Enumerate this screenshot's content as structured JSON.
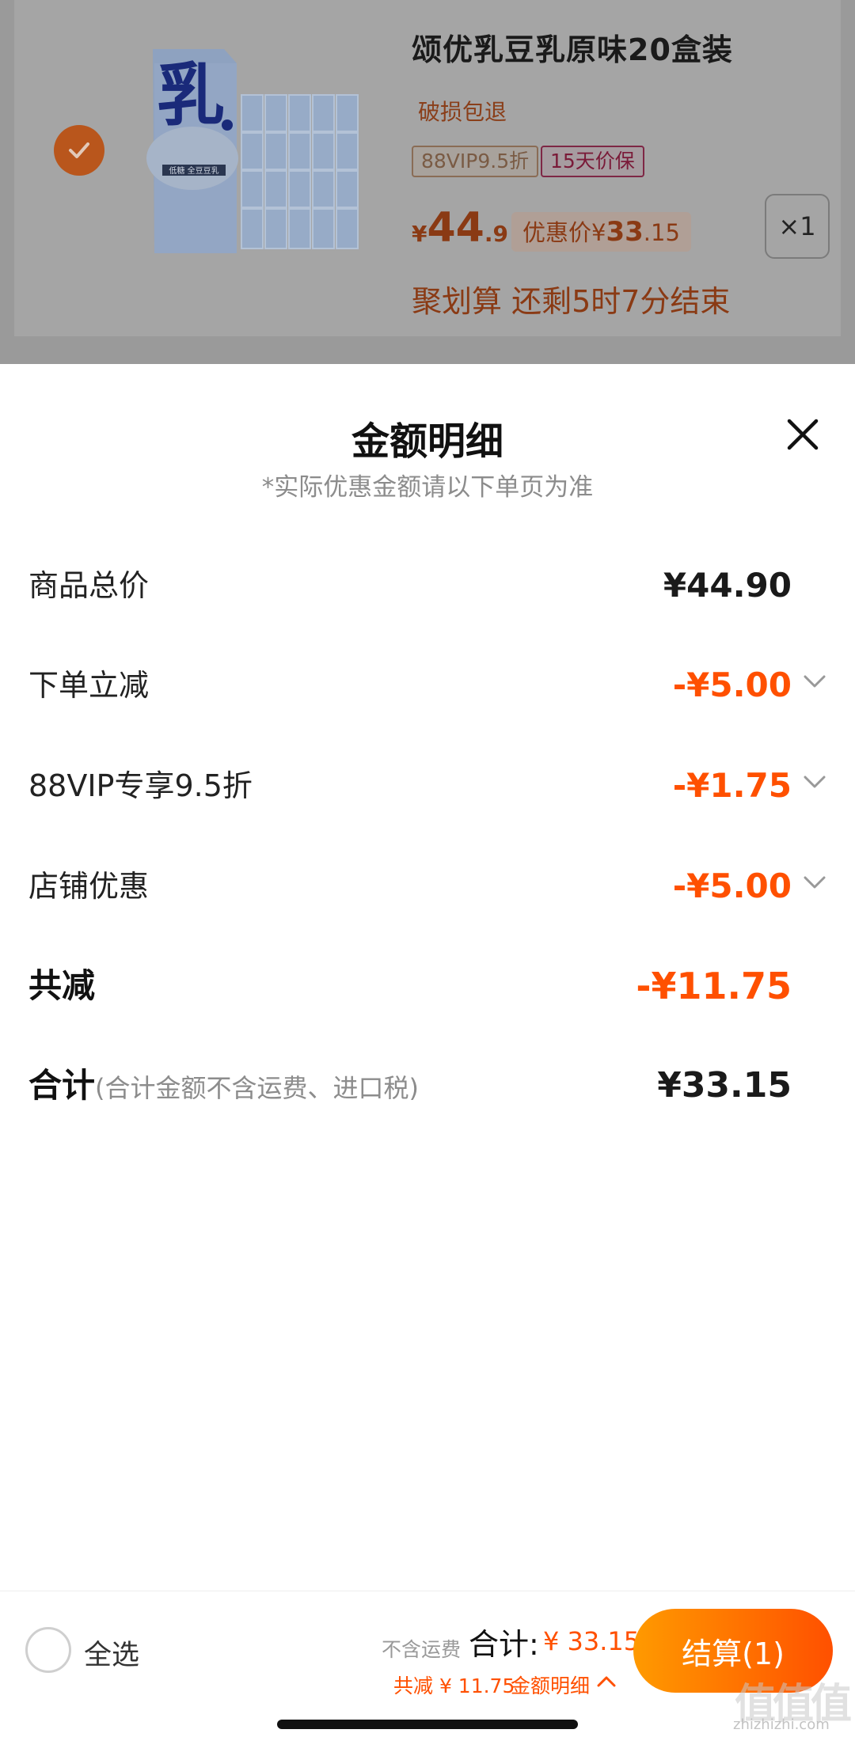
{
  "product": {
    "title": "颂优乳豆乳原味20盒装",
    "service": "破损包退",
    "tags": [
      "88VIP9.5折",
      "15天价保"
    ],
    "price_symbol": "¥",
    "price_int": "44",
    "price_dec": ".9",
    "deal_label": "优惠价¥",
    "deal_int": "33",
    "deal_dec": ".15",
    "quantity": "×1",
    "promo": "聚划算 还剩5时7分结束",
    "image_text": "乳"
  },
  "sheet": {
    "title": "金额明细",
    "note": "*实际优惠金额请以下单页为准",
    "rows": [
      {
        "label": "商品总价",
        "value": "¥44.90"
      },
      {
        "label": "下单立减",
        "value": "-¥5.00"
      },
      {
        "label": "88VIP专享9.5折",
        "value": "-¥1.75"
      },
      {
        "label": "店铺优惠",
        "value": "-¥5.00"
      },
      {
        "label": "共减",
        "value": "-¥11.75"
      },
      {
        "label": "合计",
        "sub": "(合计金额不含运费、进口税)",
        "value": "¥33.15"
      }
    ]
  },
  "bottom": {
    "select_all": "全选",
    "excl_ship": "不含运费",
    "total_label": "合计:",
    "total_value": "¥ 33.15",
    "saved": "共减 ¥ 11.75",
    "detail_link": "金额明细",
    "checkout": "结算(1)"
  },
  "watermark": {
    "text": "值值值",
    "sub": "zhizhizhi.com"
  },
  "colors": {
    "accent": "#ff5000",
    "dim": "#9a9a9a"
  }
}
